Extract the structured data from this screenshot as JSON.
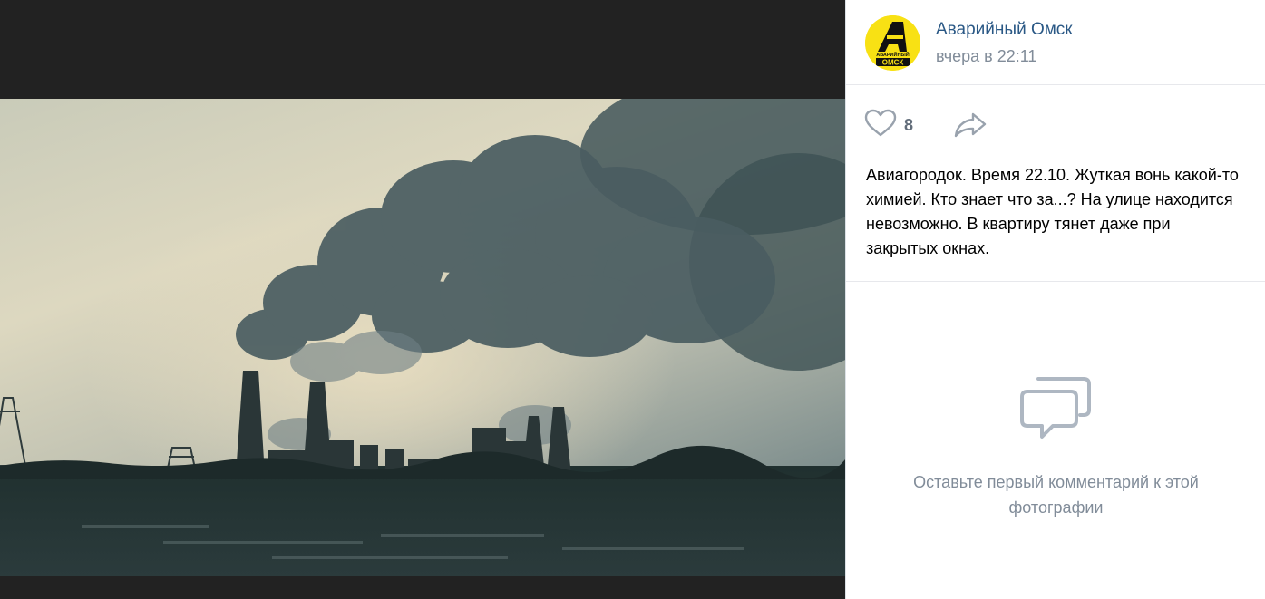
{
  "post": {
    "author": "Аварийный Омск",
    "time": "вчера в 22:11",
    "avatar_text_top": "АВАРИЙНЫЙ",
    "avatar_text_bottom": "ОМСК",
    "text": "Авиагородок. Время 22.10. Жуткая вонь какой-то химией. Кто знает что за...? На улице находится невозможно. В квартиру тянет даже при закрытых окнах.",
    "likes": "8"
  },
  "comments": {
    "empty_text": "Оставьте первый комментарий к этой фотографии"
  },
  "icons": {
    "like": "heart-icon",
    "share": "share-arrow-icon",
    "comments": "comment-bubbles-icon"
  },
  "colors": {
    "link": "#2a5885",
    "secondary": "#818c99",
    "avatar_bg": "#f8e114",
    "viewer_bg": "#222222"
  }
}
